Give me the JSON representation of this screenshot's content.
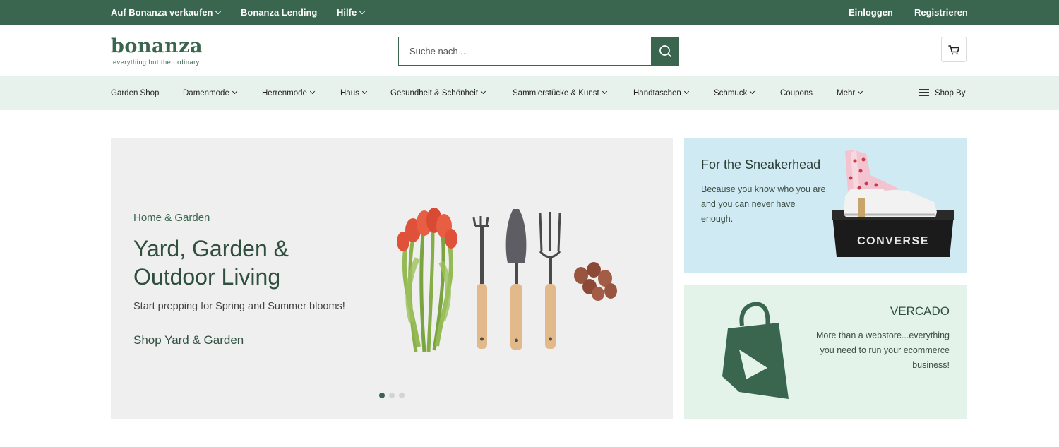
{
  "colors": {
    "brand": "#3a6650",
    "nav_bg": "#e8f2ed",
    "hero_bg": "#efefef",
    "card1_bg": "#cfeaf3",
    "card2_bg": "#e3f3e9"
  },
  "topbar": {
    "sell": "Auf Bonanza verkaufen",
    "lending": "Bonanza Lending",
    "help": "Hilfe",
    "login": "Einloggen",
    "register": "Registrieren"
  },
  "header": {
    "logo_word": "bonanza",
    "logo_tagline": "everything but the ordinary",
    "search_placeholder": "Suche nach ...",
    "search_icon": "search-icon",
    "cart_icon": "cart-icon"
  },
  "categories": [
    {
      "label": "Garden Shop",
      "has_menu": false
    },
    {
      "label": "Damenmode",
      "has_menu": true
    },
    {
      "label": "Herrenmode",
      "has_menu": true
    },
    {
      "label": "Haus",
      "has_menu": true
    },
    {
      "label": "Gesundheit & Schönheit",
      "has_menu": true
    },
    {
      "label": "Sammlerstücke & Kunst",
      "has_menu": true
    },
    {
      "label": "Handtaschen",
      "has_menu": true
    },
    {
      "label": "Schmuck",
      "has_menu": true
    },
    {
      "label": "Coupons",
      "has_menu": false
    },
    {
      "label": "Mehr",
      "has_menu": true
    }
  ],
  "shop_by": "Shop By",
  "hero": {
    "eyebrow": "Home & Garden",
    "title": "Yard, Garden & Outdoor Living",
    "subtitle": "Start prepping for Spring and Summer blooms!",
    "cta": "Shop Yard & Garden",
    "slide_count": 3,
    "active_slide": 1
  },
  "card_sneaker": {
    "title": "For the Sneakerhead",
    "text": "Because you know who you are and you can never have enough.",
    "box_brand": "CONVERSE"
  },
  "card_vercado": {
    "title": "VERCADO",
    "text": "More than a webstore...everything you need to run your ecommerce business!"
  }
}
